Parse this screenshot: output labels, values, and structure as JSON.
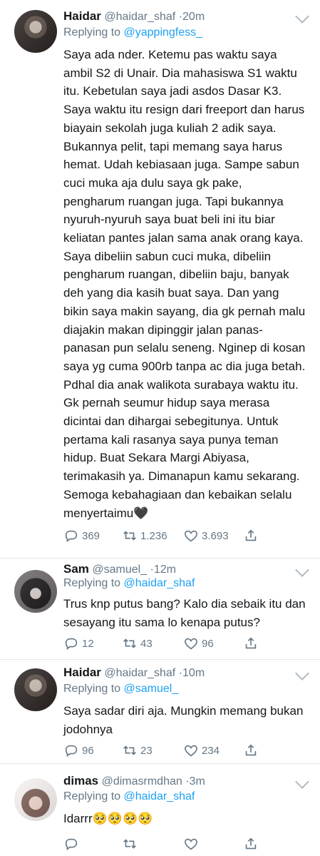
{
  "tweets": [
    {
      "name": "Haidar",
      "handle": "@haidar_shaf",
      "time": "20m",
      "replying_label": "Replying to",
      "replying_to": "@yappingfess_",
      "text": "Saya ada nder. Ketemu pas waktu saya ambil S2 di Unair. Dia mahasiswa S1 waktu itu. Kebetulan saya jadi asdos Dasar K3. Saya waktu itu resign dari freeport dan harus biayain sekolah juga kuliah 2 adik saya. Bukannya pelit, tapi memang saya harus hemat. Udah kebiasaan juga. Sampe sabun cuci muka aja dulu saya gk pake, pengharum ruangan juga. Tapi bukannya nyuruh-nyuruh saya buat beli ini itu biar keliatan pantes jalan sama anak orang kaya. Saya dibeliin sabun cuci muka, dibeliin pengharum ruangan, dibeliin baju, banyak deh yang dia kasih buat saya. Dan yang bikin saya makin sayang, dia gk pernah malu diajakin makan dipinggir jalan panas-panasan pun selalu seneng. Nginep di kosan saya yg cuma 900rb tanpa ac dia juga betah. Pdhal dia anak walikota surabaya waktu itu. Gk pernah seumur hidup saya merasa dicintai dan dihargai sebegitunya. Untuk pertama kali rasanya saya punya teman hidup. Buat Sekara Margi Abiyasa, terimakasih ya. Dimanapun kamu sekarang. Semoga kebahagiaan dan kebaikan selalu menyertaimu🖤",
      "replies": "369",
      "retweets": "1.236",
      "likes": "3.693"
    },
    {
      "name": "Sam",
      "handle": "@samuel_",
      "time": "12m",
      "replying_label": "Replying to",
      "replying_to": "@haidar_shaf",
      "text": "Trus knp putus bang? Kalo dia sebaik itu dan sesayang itu sama lo kenapa putus?",
      "replies": "12",
      "retweets": "43",
      "likes": "96"
    },
    {
      "name": "Haidar",
      "handle": "@haidar_shaf",
      "time": "10m",
      "replying_label": "Replying to",
      "replying_to": "@samuel_",
      "text": "Saya sadar diri aja. Mungkin memang bukan jodohnya",
      "replies": "96",
      "retweets": "23",
      "likes": "234"
    },
    {
      "name": "dimas",
      "handle": "@dimasrmdhan",
      "time": "3m",
      "replying_label": "Replying to",
      "replying_to": "@haidar_shaf",
      "text": "Idarrr🥺🥺🥺🥺",
      "replies": "",
      "retweets": "",
      "likes": ""
    }
  ],
  "icons": {
    "reply": "reply-icon",
    "retweet": "retweet-icon",
    "like": "heart-icon",
    "share": "share-icon",
    "more": "chevron-down-icon"
  },
  "colors": {
    "text": "#14171a",
    "secondary": "#657786",
    "link": "#1da1f2",
    "divider": "#e1e8ed"
  }
}
